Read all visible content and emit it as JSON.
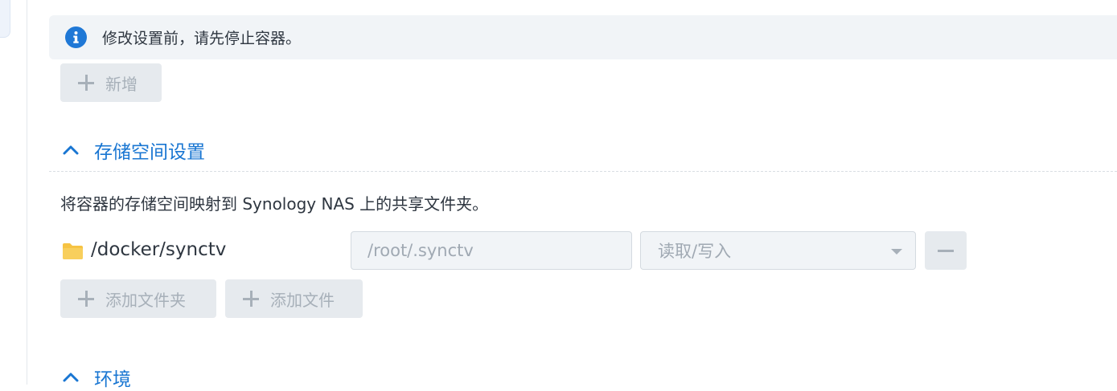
{
  "notice": {
    "text": "修改设置前，请先停止容器。",
    "icon": "info-icon"
  },
  "add_button": {
    "label": "新增"
  },
  "storage_section": {
    "title": "存储空间设置",
    "expanded": true,
    "description": "将容器的存储空间映射到 Synology NAS 上的共享文件夹。",
    "mounts": [
      {
        "icon": "folder-icon",
        "path": "/docker/synctv",
        "mount_path": "/root/.synctv",
        "mode": "读取/写入"
      }
    ],
    "add_folder_label": "添加文件夹",
    "add_file_label": "添加文件"
  },
  "environment_section": {
    "title": "环境",
    "expanded": true
  },
  "colors": {
    "accent": "#1976d2",
    "info": "#1f78d6",
    "folder": "#f6c343",
    "disabled_text": "#a7b0b9"
  }
}
